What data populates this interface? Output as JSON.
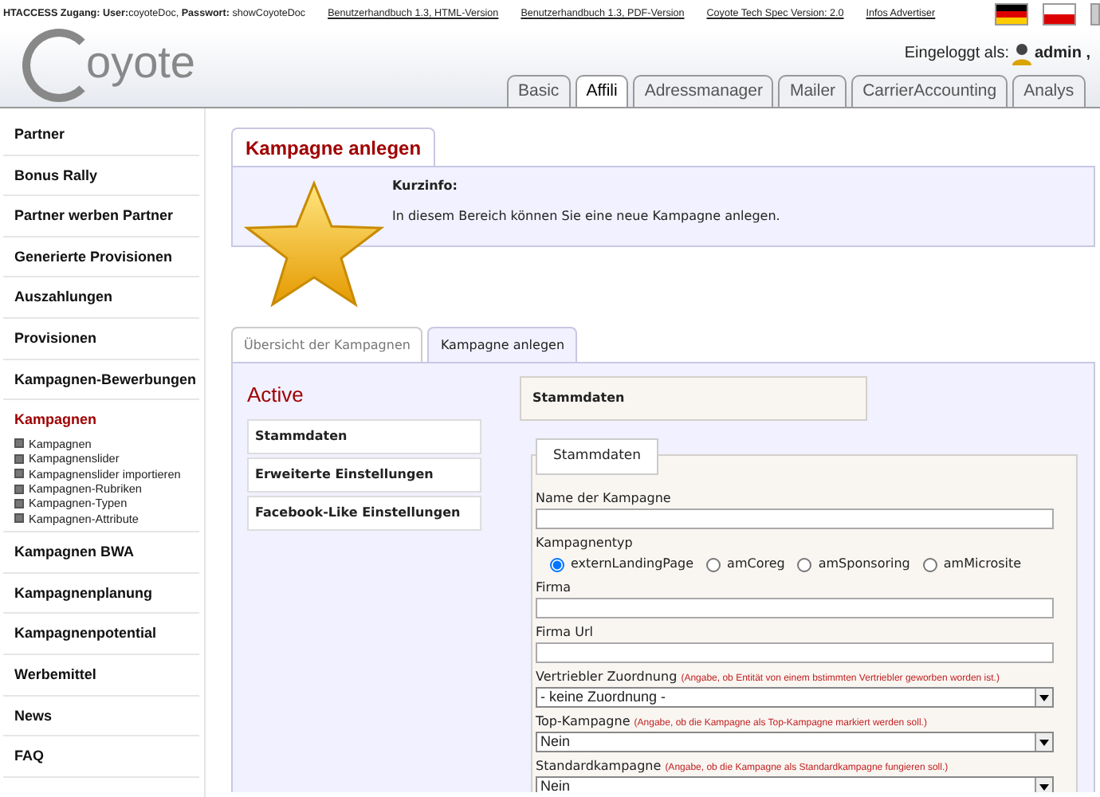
{
  "top_bar": {
    "access_info": "**HTACCESS Zugang: User:**coyoteDoc, **Passwort:** showCoyoteDoc",
    "links": [
      "Benutzerhandbuch 1.3, HTML-Version",
      "Benutzerhandbuch 1.3, PDF-Version",
      "Coyote Tech Spec Version: 2.0",
      "Infos Advertiser"
    ]
  },
  "logo": {
    "text": "oyote"
  },
  "login": {
    "label": "Eingeloggt als:",
    "user": "admin ,"
  },
  "module_tabs": [
    {
      "label": "Basic",
      "selected": false
    },
    {
      "label": "Affili",
      "selected": true
    },
    {
      "label": "Adressmanager",
      "selected": false
    },
    {
      "label": "Mailer",
      "selected": false
    },
    {
      "label": "CarrierAccounting",
      "selected": false
    },
    {
      "label": "Analys",
      "selected": false
    }
  ],
  "sidebar": {
    "items": [
      {
        "label": "Partner",
        "selected": false
      },
      {
        "label": "Bonus Rally",
        "selected": false
      },
      {
        "label": "Partner werben Partner",
        "selected": false
      },
      {
        "label": "Generierte Provisionen",
        "selected": false
      },
      {
        "label": "Auszahlungen",
        "selected": false
      },
      {
        "label": "Provisionen",
        "selected": false
      },
      {
        "label": "Kampagnen-Bewerbungen",
        "selected": false
      },
      {
        "label": "Kampagnen",
        "selected": true,
        "children": [
          {
            "label": "Kampagnen"
          },
          {
            "label": "Kampagnenslider"
          },
          {
            "label": "Kampagnenslider importieren"
          },
          {
            "label": "Kampagnen-Rubriken"
          },
          {
            "label": "Kampagnen-Typen"
          },
          {
            "label": "Kampagnen-Attribute"
          }
        ]
      },
      {
        "label": "Kampagnen BWA",
        "selected": false
      },
      {
        "label": "Kampagnenplanung",
        "selected": false
      },
      {
        "label": "Kampagnenpotential",
        "selected": false
      },
      {
        "label": "Werbemittel",
        "selected": false
      },
      {
        "label": "News",
        "selected": false
      },
      {
        "label": "FAQ",
        "selected": false
      }
    ]
  },
  "page": {
    "title": "Kampagne anlegen",
    "info_title": "Kurzinfo:",
    "info_text": "In diesem Bereich können Sie eine neue Kampagne anlegen."
  },
  "sub_tabs": [
    {
      "label": "Übersicht der Kampagnen",
      "selected": false
    },
    {
      "label": "Kampagne anlegen",
      "selected": true
    }
  ],
  "status_heading": "Active",
  "section_menu": [
    "Stammdaten",
    "Erweiterte Einstellungen",
    "Facebook-Like Einstellungen"
  ],
  "section_header": "Stammdaten",
  "fieldset": {
    "legend": "Stammdaten",
    "fields": [
      {
        "kind": "text",
        "label": "Name der Kampagne"
      },
      {
        "kind": "radio",
        "label": "Kampagnentyp",
        "options": [
          {
            "label": "externLandingPage",
            "selected": true
          },
          {
            "label": "amCoreg",
            "selected": false
          },
          {
            "label": "amSponsoring",
            "selected": false
          },
          {
            "label": "amMicrosite",
            "selected": false
          }
        ]
      },
      {
        "kind": "text",
        "label": "Firma"
      },
      {
        "kind": "text",
        "label": "Firma Url"
      },
      {
        "kind": "select",
        "label": "Vertriebler Zuordnung",
        "hint": "(Angabe, ob Entität von einem bstimmten Vertriebler geworben worden ist.)",
        "value": "- keine Zuordnung -"
      },
      {
        "kind": "select",
        "label": "Top-Kampagne",
        "hint": "(Angabe, ob die Kampagne als Top-Kampagne markiert werden soll.)",
        "value": "Nein"
      },
      {
        "kind": "select",
        "label": "Standardkampagne",
        "hint": "(Angabe, ob die Kampagne als Standardkampagne fungieren soll.)",
        "value": "Nein"
      }
    ]
  }
}
